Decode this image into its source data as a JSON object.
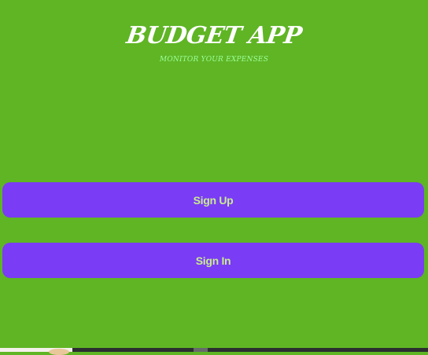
{
  "header": {
    "title": "BUDGET APP",
    "subtitle": "MONITOR YOUR EXPENSES"
  },
  "actions": {
    "sign_up_label": "Sign Up",
    "sign_in_label": "Sign In"
  },
  "colors": {
    "background": "#5fb524",
    "button": "#7a3cf5",
    "button_text": "#c9ec8f",
    "title": "#ffffff",
    "subtitle": "#9cff9a"
  }
}
